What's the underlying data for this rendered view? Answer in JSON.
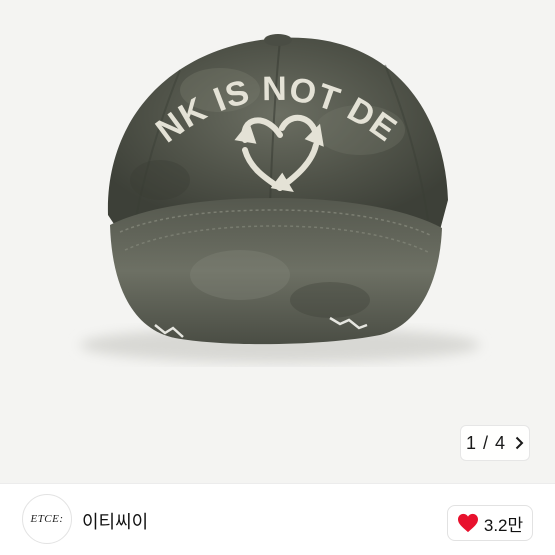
{
  "product": {
    "image_alt_icon": "cap-photo",
    "embroidery_text": "PUNK IS NOT DEAD"
  },
  "pager": {
    "current": "1",
    "separator": "/",
    "total": "4"
  },
  "seller": {
    "avatar_text": "ETCE:",
    "name": "이티씨이"
  },
  "like": {
    "count": "3.2만",
    "icon": "heart-icon",
    "color": "#e8112d"
  }
}
